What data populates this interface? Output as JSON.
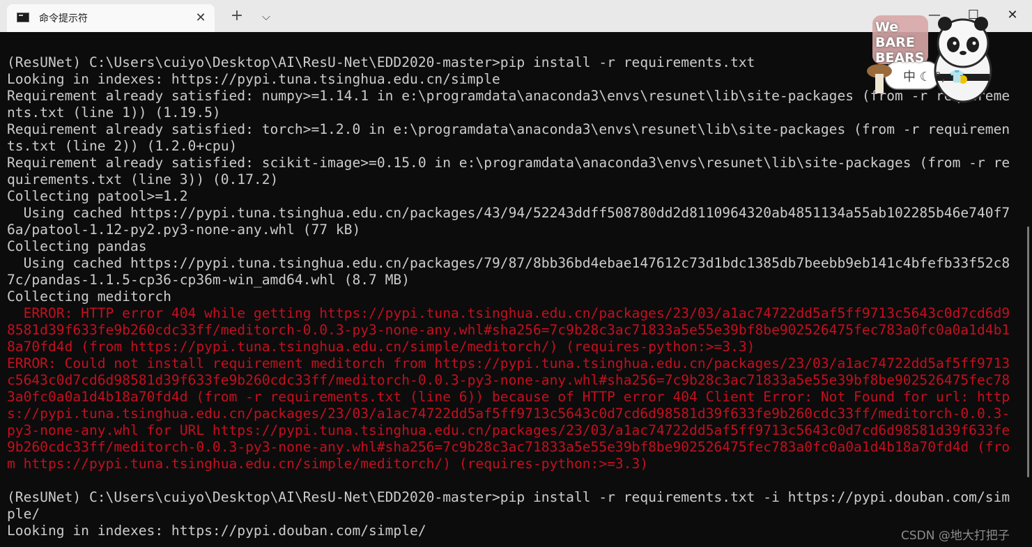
{
  "window": {
    "tab_title": "命令提示符",
    "tab_close_glyph": "✕",
    "new_tab_glyph": "+",
    "dropdown_glyph": "⌵",
    "minimize_glyph": "—",
    "maximize_glyph": "☐",
    "close_glyph": "✕"
  },
  "colors": {
    "background": "#0c0c0c",
    "text": "#cccccc",
    "error": "#c50f1f",
    "titlebar": "#e9e9e9",
    "active_tab": "#f9f9f9"
  },
  "icons": [
    "cmd-prompt-icon",
    "close-icon",
    "plus-icon",
    "chevron-down-icon",
    "minimize-icon",
    "maximize-icon",
    "close-window-icon"
  ],
  "terminal": {
    "lines": [
      {
        "text": "(ResUNet) C:\\Users\\cuiyo\\Desktop\\AI\\ResU-Net\\EDD2020-master>pip install -r requirements.txt",
        "type": "normal"
      },
      {
        "text": "Looking in indexes: https://pypi.tuna.tsinghua.edu.cn/simple",
        "type": "normal"
      },
      {
        "text": "Requirement already satisfied: numpy>=1.14.1 in e:\\programdata\\anaconda3\\envs\\resunet\\lib\\site-packages (from -r requirements.txt (line 1)) (1.19.5)",
        "type": "normal"
      },
      {
        "text": "Requirement already satisfied: torch>=1.2.0 in e:\\programdata\\anaconda3\\envs\\resunet\\lib\\site-packages (from -r requirements.txt (line 2)) (1.2.0+cpu)",
        "type": "normal"
      },
      {
        "text": "Requirement already satisfied: scikit-image>=0.15.0 in e:\\programdata\\anaconda3\\envs\\resunet\\lib\\site-packages (from -r requirements.txt (line 3)) (0.17.2)",
        "type": "normal"
      },
      {
        "text": "Collecting patool>=1.2",
        "type": "normal"
      },
      {
        "text": "  Using cached https://pypi.tuna.tsinghua.edu.cn/packages/43/94/52243ddff508780dd2d8110964320ab4851134a55ab102285b46e740f76a/patool-1.12-py2.py3-none-any.whl (77 kB)",
        "type": "normal"
      },
      {
        "text": "Collecting pandas",
        "type": "normal"
      },
      {
        "text": "  Using cached https://pypi.tuna.tsinghua.edu.cn/packages/79/87/8bb36bd4ebae147612c73d1bdc1385db7beebb9eb141c4bfefb33f52c87c/pandas-1.1.5-cp36-cp36m-win_amd64.whl (8.7 MB)",
        "type": "normal"
      },
      {
        "text": "Collecting meditorch",
        "type": "normal"
      },
      {
        "text": "  ERROR: HTTP error 404 while getting https://pypi.tuna.tsinghua.edu.cn/packages/23/03/a1ac74722dd5af5ff9713c5643c0d7cd6d98581d39f633fe9b260cdc33ff/meditorch-0.0.3-py3-none-any.whl#sha256=7c9b28c3ac71833a5e55e39bf8be902526475fec783a0fc0a0a1d4b18a70fd4d (from https://pypi.tuna.tsinghua.edu.cn/simple/meditorch/) (requires-python:>=3.3)",
        "type": "error"
      },
      {
        "text": "ERROR: Could not install requirement meditorch from https://pypi.tuna.tsinghua.edu.cn/packages/23/03/a1ac74722dd5af5ff9713c5643c0d7cd6d98581d39f633fe9b260cdc33ff/meditorch-0.0.3-py3-none-any.whl#sha256=7c9b28c3ac71833a5e55e39bf8be902526475fec783a0fc0a0a1d4b18a70fd4d (from -r requirements.txt (line 6)) because of HTTP error 404 Client Error: Not Found for url: https://pypi.tuna.tsinghua.edu.cn/packages/23/03/a1ac74722dd5af5ff9713c5643c0d7cd6d98581d39f633fe9b260cdc33ff/meditorch-0.0.3-py3-none-any.whl for URL https://pypi.tuna.tsinghua.edu.cn/packages/23/03/a1ac74722dd5af5ff9713c5643c0d7cd6d98581d39f633fe9b260cdc33ff/meditorch-0.0.3-py3-none-any.whl#sha256=7c9b28c3ac71833a5e55e39bf8be902526475fec783a0fc0a0a1d4b18a70fd4d (from https://pypi.tuna.tsinghua.edu.cn/simple/meditorch/) (requires-python:>=3.3)",
        "type": "error"
      },
      {
        "text": "",
        "type": "normal"
      },
      {
        "text": "(ResUNet) C:\\Users\\cuiyo\\Desktop\\AI\\ResU-Net\\EDD2020-master>pip install -r requirements.txt -i https://pypi.douban.com/simple/",
        "type": "normal"
      },
      {
        "text": "Looking in indexes: https://pypi.douban.com/simple/",
        "type": "normal"
      }
    ]
  },
  "sticker": {
    "logo_lines": [
      "We",
      "BARE",
      "BEARS"
    ],
    "text": "中 ☾ °, 👕"
  },
  "watermark": "CSDN @地大打把子"
}
